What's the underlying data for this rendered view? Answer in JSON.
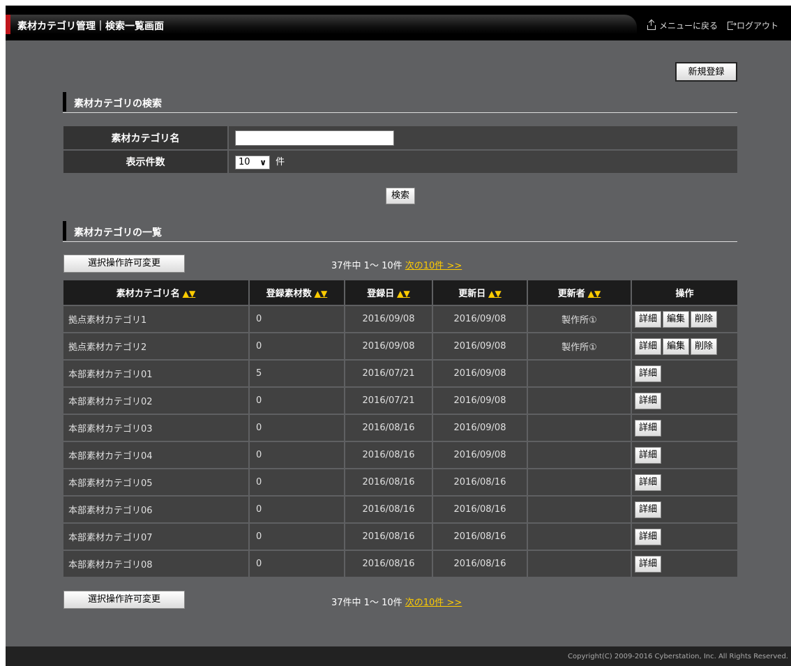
{
  "header": {
    "title": "素材カテゴリ管理｜検索一覧画面",
    "menu_link": "メニューに戻る",
    "logout_link": "ログアウト"
  },
  "actions": {
    "new_label": "新規登録"
  },
  "search": {
    "heading": "素材カテゴリの検索",
    "name_label": "素材カテゴリ名",
    "name_value": "",
    "count_label": "表示件数",
    "count_value": "10",
    "count_unit": "件",
    "search_label": "検索"
  },
  "list": {
    "heading": "素材カテゴリの一覧",
    "perm_button": "選択操作許可変更",
    "pager_text": "37件中 1～ 10件 ",
    "pager_next": "次の10件 >>",
    "sort_glyph": "▲▼",
    "columns": [
      "素材カテゴリ名",
      "登録素材数",
      "登録日",
      "更新日",
      "更新者",
      "操作"
    ],
    "op_labels": {
      "detail": "詳細",
      "edit": "編集",
      "delete": "削除"
    },
    "rows": [
      {
        "name": "拠点素材カテゴリ1",
        "count": "0",
        "created": "2016/09/08",
        "updated": "2016/09/08",
        "updater": "製作所①",
        "ops": [
          "detail",
          "edit",
          "delete"
        ]
      },
      {
        "name": "拠点素材カテゴリ2",
        "count": "0",
        "created": "2016/09/08",
        "updated": "2016/09/08",
        "updater": "製作所①",
        "ops": [
          "detail",
          "edit",
          "delete"
        ]
      },
      {
        "name": "本部素材カテゴリ01",
        "count": "5",
        "created": "2016/07/21",
        "updated": "2016/09/08",
        "updater": "",
        "ops": [
          "detail"
        ]
      },
      {
        "name": "本部素材カテゴリ02",
        "count": "0",
        "created": "2016/07/21",
        "updated": "2016/09/08",
        "updater": "",
        "ops": [
          "detail"
        ]
      },
      {
        "name": "本部素材カテゴリ03",
        "count": "0",
        "created": "2016/08/16",
        "updated": "2016/09/08",
        "updater": "",
        "ops": [
          "detail"
        ]
      },
      {
        "name": "本部素材カテゴリ04",
        "count": "0",
        "created": "2016/08/16",
        "updated": "2016/09/08",
        "updater": "",
        "ops": [
          "detail"
        ]
      },
      {
        "name": "本部素材カテゴリ05",
        "count": "0",
        "created": "2016/08/16",
        "updated": "2016/08/16",
        "updater": "",
        "ops": [
          "detail"
        ]
      },
      {
        "name": "本部素材カテゴリ06",
        "count": "0",
        "created": "2016/08/16",
        "updated": "2016/08/16",
        "updater": "",
        "ops": [
          "detail"
        ]
      },
      {
        "name": "本部素材カテゴリ07",
        "count": "0",
        "created": "2016/08/16",
        "updated": "2016/08/16",
        "updater": "",
        "ops": [
          "detail"
        ]
      },
      {
        "name": "本部素材カテゴリ08",
        "count": "0",
        "created": "2016/08/16",
        "updated": "2016/08/16",
        "updater": "",
        "ops": [
          "detail"
        ]
      }
    ]
  },
  "footer": {
    "copyright": "Copyright(C) 2009-2016 Cyberstation, Inc. All Rights Reserved."
  }
}
